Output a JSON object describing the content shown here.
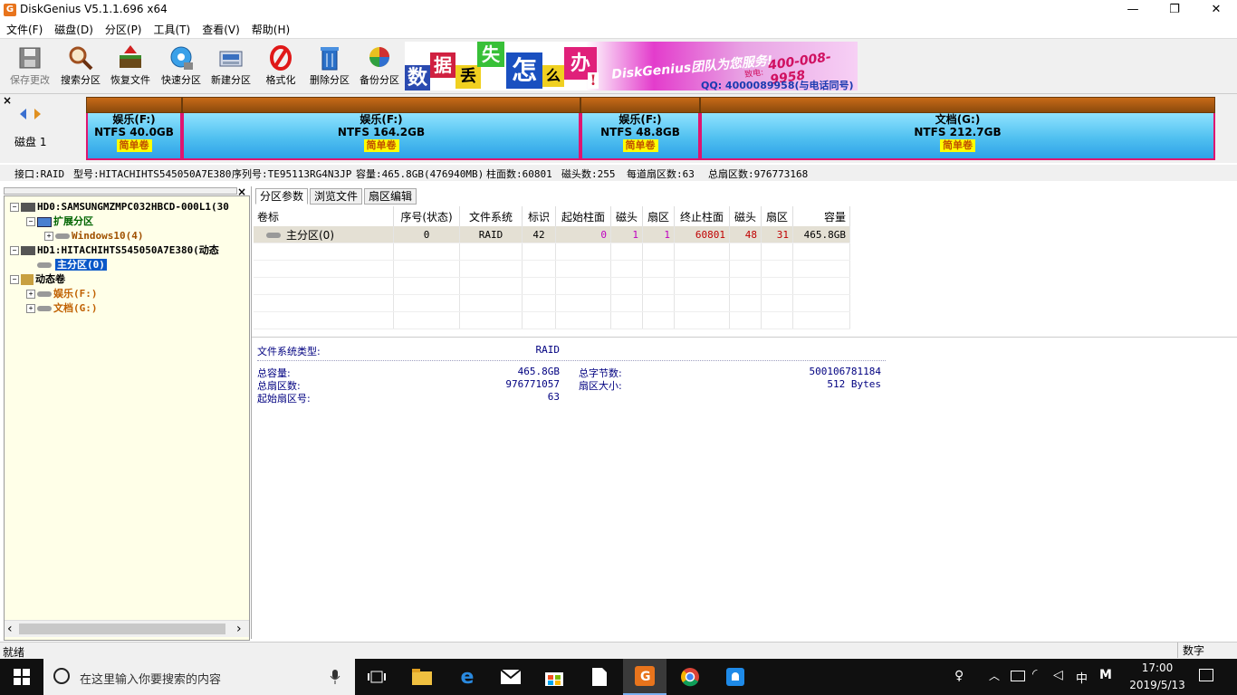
{
  "window": {
    "title": "DiskGenius V5.1.1.696 x64",
    "icon_letter": "G",
    "min": "—",
    "max": "❐",
    "close": "✕"
  },
  "menu": [
    "文件(F)",
    "磁盘(D)",
    "分区(P)",
    "工具(T)",
    "查看(V)",
    "帮助(H)"
  ],
  "toolbar": [
    {
      "label": "保存更改",
      "icon": "save-disk-icon"
    },
    {
      "label": "搜索分区",
      "icon": "magnifier-icon"
    },
    {
      "label": "恢复文件",
      "icon": "recover-box-icon"
    },
    {
      "label": "快速分区",
      "icon": "quick-partition-icon"
    },
    {
      "label": "新建分区",
      "icon": "new-partition-icon"
    },
    {
      "label": "格式化",
      "icon": "format-icon"
    },
    {
      "label": "删除分区",
      "icon": "trash-icon"
    },
    {
      "label": "备份分区",
      "icon": "backup-pie-icon"
    }
  ],
  "banner": {
    "chars": [
      "数",
      "据",
      "丢",
      "失",
      "怎",
      "么",
      "办",
      "!"
    ],
    "team": "DiskGenius团队为您服务!",
    "phone": "400-008-9958",
    "phone_prefix": "致电:",
    "qq": "QQ: 4000089958(与电话同号)"
  },
  "diskmap": {
    "close": "×",
    "disk_label": "磁盘 1",
    "partitions": [
      {
        "name": "娱乐(F:)",
        "fs": "NTFS 40.0GB",
        "type": "简单卷"
      },
      {
        "name": "娱乐(F:)",
        "fs": "NTFS 164.2GB",
        "type": "简单卷"
      },
      {
        "name": "娱乐(F:)",
        "fs": "NTFS 48.8GB",
        "type": "简单卷"
      },
      {
        "name": "文档(G:)",
        "fs": "NTFS 212.7GB",
        "type": "简单卷"
      }
    ]
  },
  "diskinfo": {
    "iface": "接口:RAID",
    "model": "型号:HITACHIHTS545050A7E380",
    "serial": "序列号:TE95113RG4N3JP",
    "capacity": "容量:465.8GB(476940MB)",
    "cylinders": "柱面数:60801",
    "heads": "磁头数:255",
    "spt": "每道扇区数:63",
    "sectors": "总扇区数:976773168"
  },
  "tree": {
    "close": "×",
    "nodes": [
      {
        "label": "HD0:SAMSUNGMZMPC032HBCD-000L1(30",
        "color": "#000"
      },
      {
        "label": "扩展分区",
        "color": "#006400"
      },
      {
        "label": "Windows10(4)",
        "color": "#a05000"
      },
      {
        "label": "HD1:HITACHIHTS545050A7E380(动态",
        "color": "#000"
      },
      {
        "label": "主分区(0)",
        "color": "#fff"
      },
      {
        "label": "动态卷",
        "color": "#000"
      },
      {
        "label": "娱乐(F:)",
        "color": "#c06000"
      },
      {
        "label": "文档(G:)",
        "color": "#c06000"
      }
    ],
    "scroll_left": "‹",
    "scroll_right": "›"
  },
  "tabs": [
    "分区参数",
    "浏览文件",
    "扇区编辑"
  ],
  "table": {
    "headers": [
      "卷标",
      "序号(状态)",
      "文件系统",
      "标识",
      "起始柱面",
      "磁头",
      "扇区",
      "终止柱面",
      "磁头",
      "扇区",
      "容量"
    ],
    "rows": [
      [
        "主分区(0)",
        "0",
        "RAID",
        "42",
        "0",
        "1",
        "1",
        "60801",
        "48",
        "31",
        "465.8GB"
      ]
    ]
  },
  "details": {
    "fs_type_label": "文件系统类型:",
    "fs_type": "RAID",
    "total_cap_label": "总容量:",
    "total_cap": "465.8GB",
    "total_bytes_label": "总字节数:",
    "total_bytes": "500106781184",
    "total_sectors_label": "总扇区数:",
    "total_sectors": "976771057",
    "sector_size_label": "扇区大小:",
    "sector_size": "512 Bytes",
    "start_sector_label": "起始扇区号:",
    "start_sector": "63"
  },
  "status": {
    "left": "就绪",
    "right": "数字"
  },
  "taskbar": {
    "search_placeholder": "在这里输入你要搜索的内容",
    "ime": "中",
    "ime2": "M",
    "time": "17:00",
    "date": "2019/5/13"
  }
}
